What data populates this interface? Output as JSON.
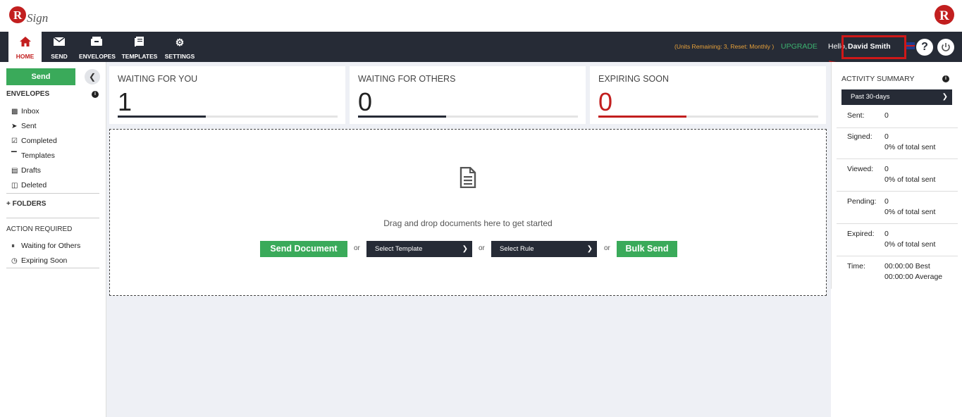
{
  "nav": {
    "items": [
      {
        "label": "HOME",
        "icon": "home-icon"
      },
      {
        "label": "SEND",
        "icon": "envelope-icon"
      },
      {
        "label": "ENVELOPES",
        "icon": "inbox-tray-icon"
      },
      {
        "label": "TEMPLATES",
        "icon": "book-icon"
      },
      {
        "label": "SETTINGS",
        "icon": "gear-icon"
      }
    ],
    "units": "(Units Remaining: 3, Reset: Monthly )",
    "upgrade": "UPGRADE",
    "hello": "Hello,",
    "username": "David Smith",
    "help": "?",
    "accent": "#c21f1f"
  },
  "sidebar": {
    "send": "Send",
    "envelopes_title": "ENVELOPES",
    "items": [
      "Inbox",
      "Sent",
      "Completed",
      "Templates",
      "Drafts",
      "Deleted"
    ],
    "folders": "+ FOLDERS",
    "action_title": "ACTION REQUIRED",
    "actions": [
      "Waiting for Others",
      "Expiring Soon"
    ]
  },
  "cards": [
    {
      "title": "WAITING FOR YOU",
      "value": "1",
      "progress": 0.4,
      "color": "#262b36"
    },
    {
      "title": "WAITING FOR OTHERS",
      "value": "0",
      "progress": 0.4,
      "color": "#262b36"
    },
    {
      "title": "EXPIRING SOON",
      "value": "0",
      "progress": 0.4,
      "color": "#c21f1f"
    }
  ],
  "dropzone": {
    "text": "Drag and drop documents here to get started",
    "send_document": "Send Document",
    "or": "or",
    "select_template": "Select Template",
    "select_rule": "Select Rule",
    "bulk_send": "Bulk Send"
  },
  "activity": {
    "title": "ACTIVITY SUMMARY",
    "period": "Past 30-days",
    "rows": [
      {
        "label": "Sent:",
        "value": "0",
        "pct": ""
      },
      {
        "label": "Signed:",
        "value": "0",
        "pct": "0% of total sent"
      },
      {
        "label": "Viewed:",
        "value": "0",
        "pct": "0% of total sent"
      },
      {
        "label": "Pending:",
        "value": "0",
        "pct": "0% of total sent"
      },
      {
        "label": "Expired:",
        "value": "0",
        "pct": "0% of total sent"
      },
      {
        "label": "Time:",
        "value": "00:00:00 Best",
        "pct": "00:00:00 Average"
      }
    ]
  }
}
